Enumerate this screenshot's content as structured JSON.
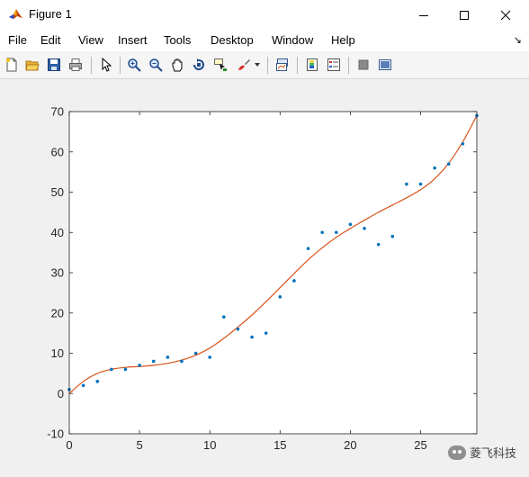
{
  "window": {
    "title": "Figure 1",
    "icon": "matlab-icon",
    "controls": [
      "minimize-icon",
      "maximize-icon",
      "close-icon"
    ]
  },
  "menu": {
    "items": [
      "File",
      "Edit",
      "View",
      "Insert",
      "Tools",
      "Desktop",
      "Window",
      "Help"
    ]
  },
  "toolbar": {
    "buttons": [
      "new-figure-icon",
      "open-icon",
      "save-icon",
      "print-icon",
      "edit-plot-icon",
      "zoom-in-icon",
      "zoom-out-icon",
      "pan-icon",
      "rotate-3d-icon",
      "data-cursor-icon",
      "brush-icon",
      "link-plot-icon",
      "colorbar-icon",
      "legend-icon",
      "hide-plot-tools-icon",
      "show-plot-tools-icon"
    ]
  },
  "watermark": {
    "text": "菱飞科技"
  },
  "colors": {
    "scatter": "#0072bd",
    "fit_line": "#d95319"
  },
  "chart_data": {
    "type": "scatter",
    "title": "",
    "xlabel": "",
    "ylabel": "",
    "xlim": [
      0,
      29
    ],
    "ylim": [
      -10,
      70
    ],
    "xticks": [
      0,
      5,
      10,
      15,
      20,
      25
    ],
    "xtick_labels": [
      "0",
      "5",
      "10",
      "15",
      "20",
      "25"
    ],
    "yticks": [
      -10,
      0,
      10,
      20,
      30,
      40,
      50,
      60,
      70
    ],
    "ytick_labels": [
      "-10",
      "0",
      "10",
      "20",
      "30",
      "40",
      "50",
      "60",
      "70"
    ],
    "grid": false,
    "series": [
      {
        "type": "scatter",
        "x": [
          0,
          1,
          2,
          3,
          4,
          5,
          6,
          7,
          8,
          9,
          10,
          11,
          12,
          13,
          14,
          15,
          16,
          17,
          18,
          19,
          20,
          21,
          22,
          23,
          24,
          25,
          26,
          27,
          28,
          29
        ],
        "y": [
          1,
          2,
          3,
          6,
          6,
          7,
          8,
          9,
          8,
          10,
          9,
          19,
          16,
          14,
          15,
          24,
          28,
          36,
          40,
          40,
          42,
          41,
          37,
          39,
          52,
          52,
          56,
          57,
          62,
          69
        ]
      },
      {
        "type": "line",
        "x": [
          0,
          1,
          2,
          3,
          4,
          5,
          6,
          7,
          8,
          9,
          10,
          11,
          12,
          13,
          14,
          15,
          16,
          17,
          18,
          19,
          20,
          21,
          22,
          23,
          24,
          25,
          26,
          27,
          28,
          29
        ],
        "y": [
          0,
          3,
          5,
          6,
          6.5,
          6.7,
          7,
          7.5,
          8.3,
          9.5,
          11.3,
          13.7,
          16.5,
          19.5,
          22.8,
          26.3,
          29.8,
          33.2,
          36.2,
          38.8,
          41,
          43,
          45,
          46.8,
          48.6,
          50.6,
          53.3,
          57.2,
          62.5,
          69
        ]
      }
    ]
  }
}
